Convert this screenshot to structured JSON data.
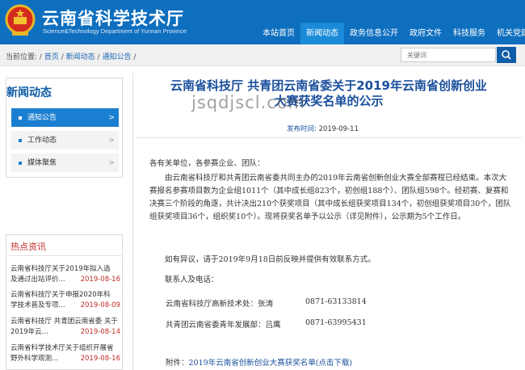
{
  "header": {
    "title": "云南省科学技术厅",
    "subtitle": "Science&Technology Department of Yunnan Province",
    "nav": [
      "本站首页",
      "新闻动态",
      "政务信息公开",
      "政府文件",
      "科技服务",
      "机关党建"
    ],
    "active_nav_index": 1
  },
  "breadcrumb": {
    "prefix": "当前位置:",
    "items": [
      "首页",
      "新闻动态",
      "通知公告"
    ],
    "sep": "/"
  },
  "search": {
    "placeholder": "关键词"
  },
  "sidebar": {
    "title": "新闻动态",
    "items": [
      {
        "label": "通知公告",
        "active": true
      },
      {
        "label": "工作动态",
        "active": false
      },
      {
        "label": "媒体聚焦",
        "active": false
      }
    ]
  },
  "hot": {
    "title": "热点资讯",
    "items": [
      {
        "line1": "云南省科技厅关于2019年拟入选",
        "line2": "及通过出站评价...",
        "date": "2019-08-16"
      },
      {
        "line1": "云南省科技厅关于申报2020年科",
        "line2": "学技术普及专项...",
        "date": "2019-08-09"
      },
      {
        "line1": "云南省科技厅 共青团云南省委 关于",
        "line2": "2019年云...",
        "date": "2019-08-14"
      },
      {
        "line1": "云南省科学技术厅关于组织开展省",
        "line2": "野外科学观测...",
        "date": "2019-08-16"
      }
    ]
  },
  "article": {
    "title_line1": "云南省科技厅 共青团云南省委关于2019年云南省创新创业",
    "title_line2": "大赛获奖名单的公示",
    "watermark": "jsqdjscl.com",
    "date_label": "发布时间:",
    "date": "2019-09-11",
    "salutation": "各有关单位，各参赛企业、团队：",
    "para1": "由云南省科技厅和共青团云南省委共同主办的2019年云南省创新创业大赛全部赛程已经结束。本次大赛报名参赛项目数为企业组1011个（其中成长组823个，初创组188个）、团队组598个。经初赛、复赛和决赛三个阶段的角逐，共计决出210个获奖项目（其中成长组获奖项目134个，初创组获奖项目30个，团队组获奖项目36个，组织奖10个）。现将获奖名单予以公示（详见附件），公示期为5个工作日。",
    "para2": "如有异议，请于2019年9月18日前反映并提供有效联系方式。",
    "contact_label": "联系人及电话：",
    "contacts": [
      {
        "org": "云南省科技厅高新技术处：张涛",
        "phone": "0871-63133814"
      },
      {
        "org": "共青团云南省委青年发展部：吕鹰",
        "phone": "0871-63995431"
      }
    ],
    "attachment_label": "附件：",
    "attachment_link": "2019年云南省创新创业大赛获奖名单(点击下载)"
  }
}
